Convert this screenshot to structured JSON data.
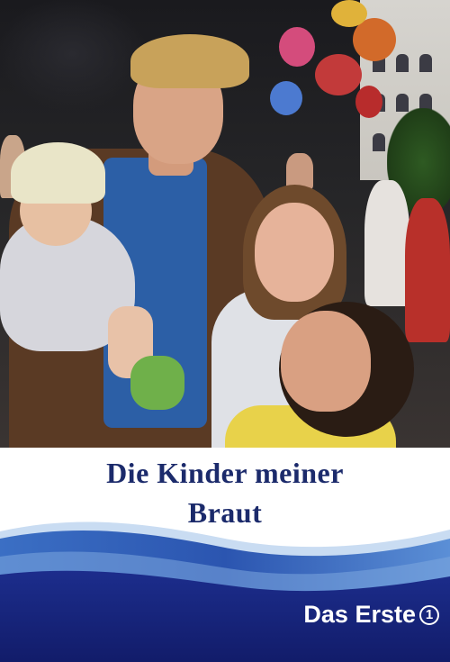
{
  "title": {
    "line1": "Die Kinder meiner",
    "line2": "Braut"
  },
  "brand": {
    "name": "Das Erste",
    "logo_mark": "1"
  },
  "colors": {
    "title_text": "#1b2a6b",
    "wave_dark": "#16227a",
    "wave_mid": "#2b55b0",
    "wave_light": "#9fc3ea"
  }
}
